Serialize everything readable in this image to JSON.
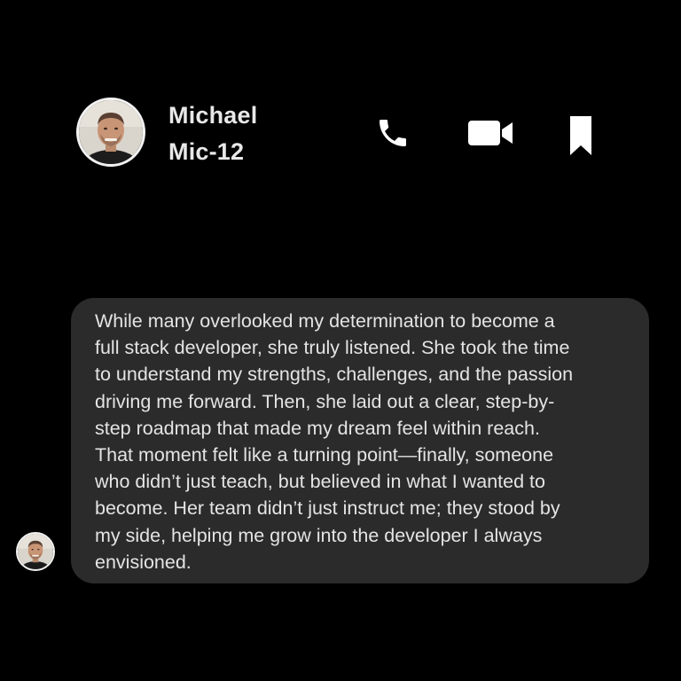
{
  "header": {
    "contact_name": "Michael",
    "contact_handle": "Mic-12",
    "actions": [
      {
        "icon": "phone-icon",
        "label": "Call"
      },
      {
        "icon": "video-camera-icon",
        "label": "Video call"
      },
      {
        "icon": "bookmark-icon",
        "label": "Bookmark"
      }
    ]
  },
  "messages": [
    {
      "direction": "incoming",
      "text": "While many overlooked my determination to become a\nfull stack developer, she truly listened. She took the time\nto understand my strengths, challenges, and the passion\ndriving me forward. Then, she laid out a clear, step-by-\nstep roadmap that made my dream feel within reach.\nThat moment felt like a turning point—finally, someone\nwho didn’t just teach, but believed in what I wanted to\nbecome. Her team didn’t just instruct me; they stood by\nmy side, helping me grow into the developer I always\nenvisioned."
    }
  ],
  "colors": {
    "background": "#000000",
    "bubble": "#2b2b2b",
    "text": "#e4e4e4",
    "icon": "#ffffff"
  }
}
